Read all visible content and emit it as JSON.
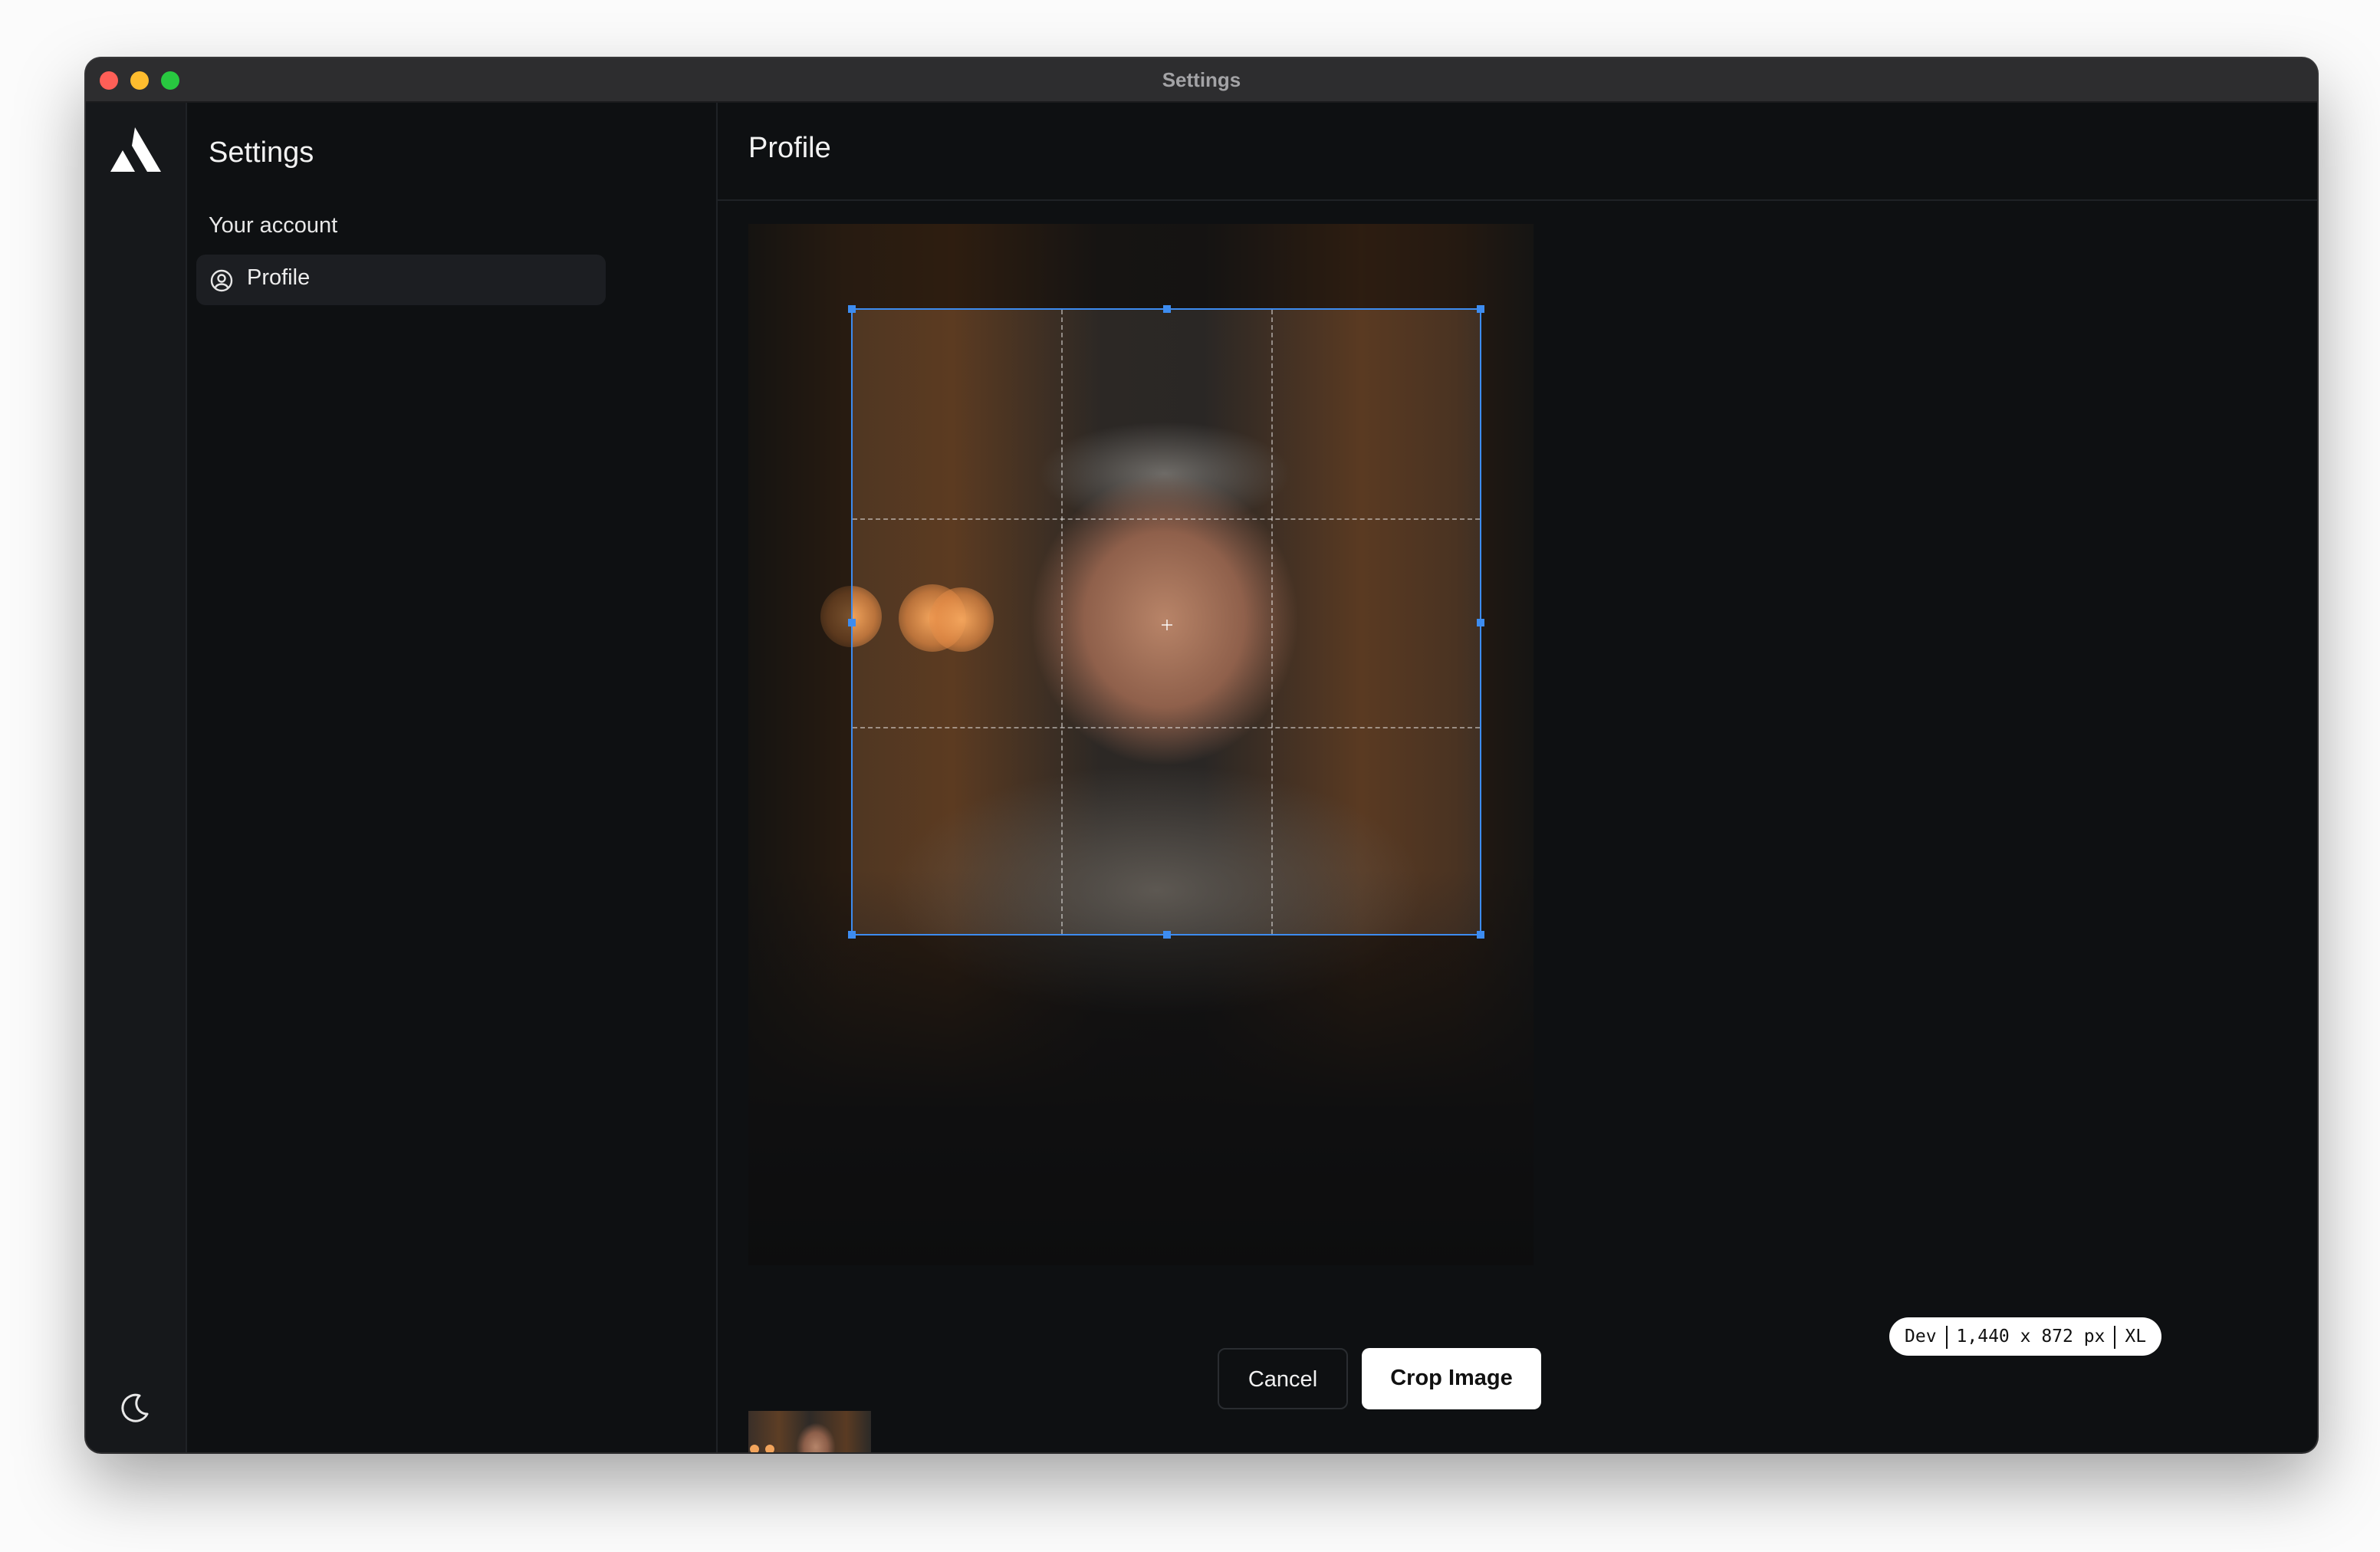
{
  "window": {
    "title": "Settings"
  },
  "sidebar": {
    "title": "Settings",
    "section_label": "Your account",
    "items": [
      {
        "label": "Profile",
        "icon": "user-circle-icon",
        "active": true
      }
    ]
  },
  "main": {
    "title": "Profile",
    "cropper": {
      "image_description_icon": "portrait-photo",
      "crop_grid": "rule-of-thirds"
    },
    "actions": {
      "cancel_label": "Cancel",
      "crop_label": "Crop Image"
    }
  },
  "dev_badge": {
    "env": "Dev",
    "viewport": "1,440 x 872 px",
    "breakpoint": "XL"
  },
  "colors": {
    "accent": "#3d8cf0",
    "background": "#0e1012",
    "titlebar": "#2d2d2f",
    "rail": "#16181b",
    "active_item": "#1c1e22"
  }
}
